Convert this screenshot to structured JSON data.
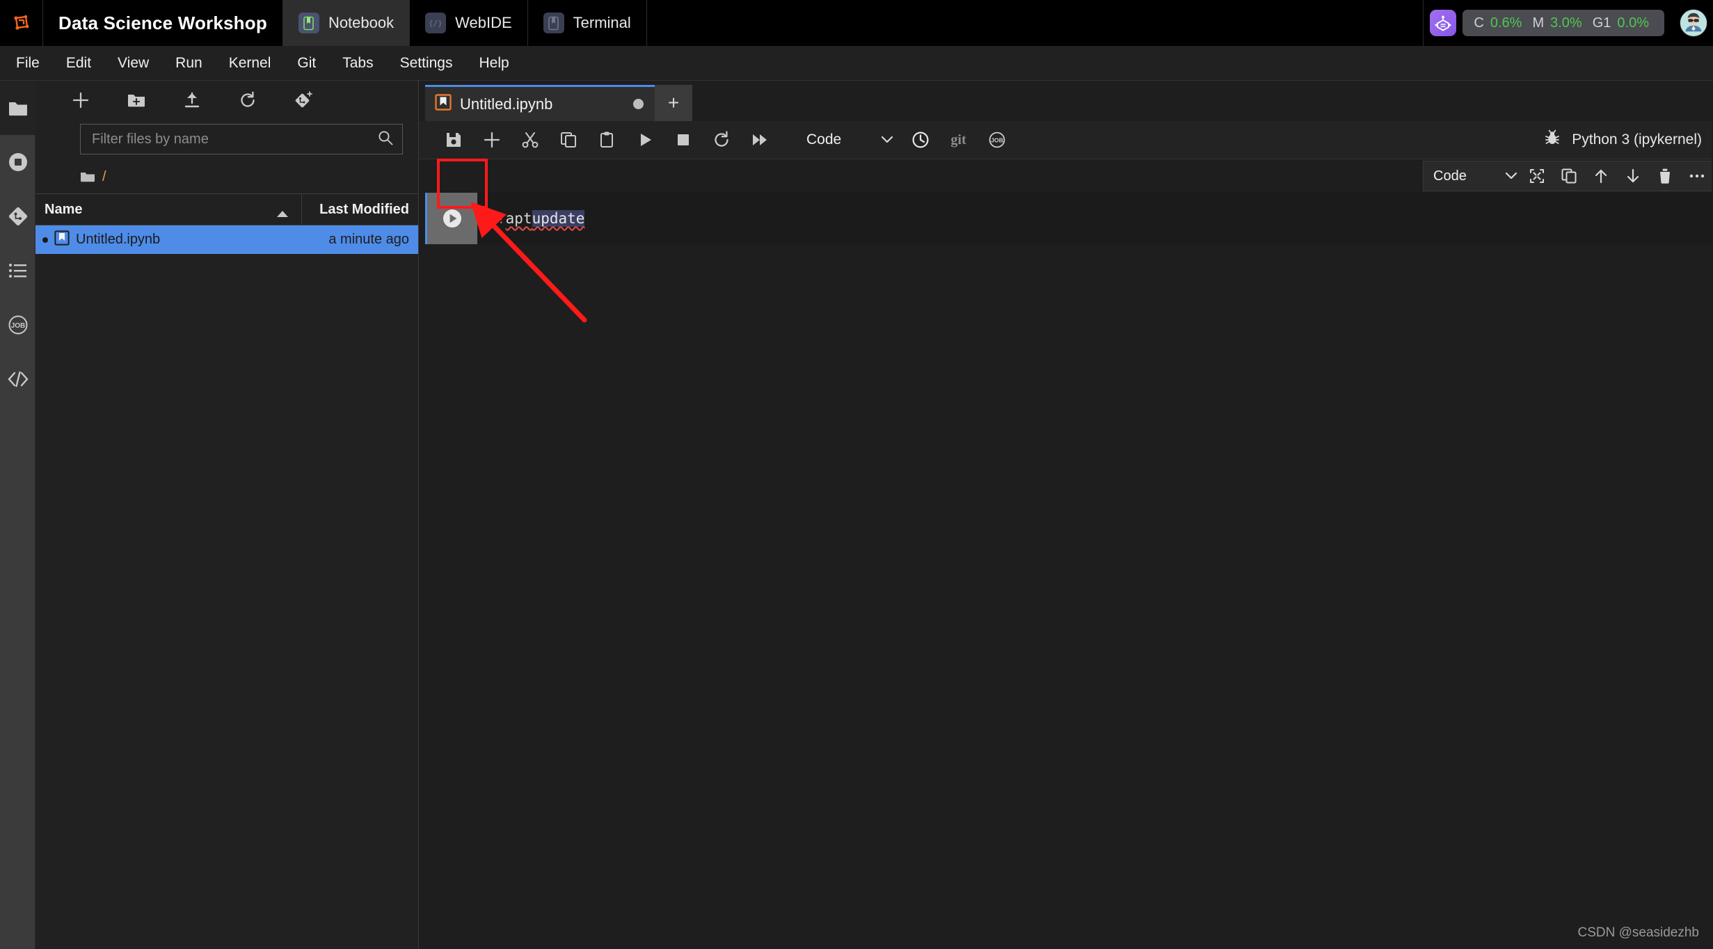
{
  "brand": {
    "logo_icon": "jupyter-like-logo-icon",
    "title": "Data Science Workshop"
  },
  "top_tabs": [
    {
      "label": "Notebook",
      "icon": "notebook-icon",
      "active": true
    },
    {
      "label": "WebIDE",
      "icon": "code-brackets-icon",
      "active": false
    },
    {
      "label": "Terminal",
      "icon": "terminal-icon",
      "active": false
    }
  ],
  "resources": {
    "assistant_icon": "ai-assistant-icon",
    "items": [
      {
        "key": "C",
        "value": "0.6%"
      },
      {
        "key": "M",
        "value": "3.0%"
      },
      {
        "key": "G1",
        "value": "0.0%"
      }
    ],
    "avatar_icon": "user-avatar"
  },
  "menubar": {
    "items": [
      "File",
      "Edit",
      "View",
      "Run",
      "Kernel",
      "Git",
      "Tabs",
      "Settings",
      "Help"
    ]
  },
  "rail": {
    "items": [
      {
        "name": "file-browser",
        "icon": "folder-icon",
        "active": true
      },
      {
        "name": "running-sessions",
        "icon": "stop-circle-icon",
        "active": false
      },
      {
        "name": "git-panel",
        "icon": "git-diamond-icon",
        "active": false
      },
      {
        "name": "table-of-contents",
        "icon": "list-icon",
        "active": false
      },
      {
        "name": "jobs-panel",
        "icon": "job-circle-icon",
        "active": false
      },
      {
        "name": "extensions",
        "icon": "code-slash-icon",
        "active": false
      }
    ]
  },
  "filebrowser": {
    "toolbar": [
      {
        "name": "new-launcher",
        "icon": "plus-icon"
      },
      {
        "name": "new-folder",
        "icon": "new-folder-icon"
      },
      {
        "name": "upload-files",
        "icon": "upload-icon"
      },
      {
        "name": "refresh-listing",
        "icon": "refresh-icon"
      },
      {
        "name": "git-clone",
        "icon": "git-clone-icon"
      }
    ],
    "filter": {
      "placeholder": "Filter files by name",
      "value": "",
      "icon": "search-icon"
    },
    "breadcrumb": {
      "icon": "folder-icon",
      "path": "/"
    },
    "columns": {
      "name": "Name",
      "modified": "Last Modified"
    },
    "sort": "ascending",
    "rows": [
      {
        "name": "Untitled.ipynb",
        "modified": "a minute ago",
        "icon": "notebook-file-icon",
        "selected": true,
        "unsaved": true
      }
    ]
  },
  "notebook": {
    "tab": {
      "title": "Untitled.ipynb",
      "icon": "notebook-file-icon",
      "unsaved_indicator": "●"
    },
    "add_tab_label": "+",
    "toolbar": {
      "buttons": [
        {
          "name": "save-notebook",
          "icon": "save-icon"
        },
        {
          "name": "insert-cell-below",
          "icon": "plus-icon"
        },
        {
          "name": "cut-cells",
          "icon": "scissors-icon"
        },
        {
          "name": "copy-cells",
          "icon": "copy-icon"
        },
        {
          "name": "paste-cells",
          "icon": "paste-icon"
        },
        {
          "name": "run-cell",
          "icon": "play-icon"
        },
        {
          "name": "interrupt-kernel",
          "icon": "stop-square-icon"
        },
        {
          "name": "restart-kernel",
          "icon": "restart-icon"
        },
        {
          "name": "restart-and-run-all",
          "icon": "fast-forward-icon"
        }
      ],
      "cell_type": {
        "value": "Code",
        "caret_icon": "chevron-down-icon"
      },
      "extras": [
        {
          "name": "history",
          "icon": "clock-icon"
        },
        {
          "name": "git-toolbar",
          "icon": "git-text-icon",
          "label": "git"
        },
        {
          "name": "job-toolbar",
          "icon": "job-circle-icon",
          "label": "JOB"
        }
      ],
      "kernel": {
        "debug_icon": "bug-icon",
        "name": "Python 3 (ipykernel)"
      }
    },
    "cell_toolbar": {
      "cell_type": {
        "value": "Code",
        "caret_icon": "chevron-down-icon"
      },
      "buttons": [
        {
          "name": "collapse-cell",
          "icon": "collapse-icon"
        },
        {
          "name": "duplicate-cell",
          "icon": "copy-icon"
        },
        {
          "name": "move-cell-up",
          "icon": "arrow-up-icon"
        },
        {
          "name": "move-cell-down",
          "icon": "arrow-down-icon"
        },
        {
          "name": "delete-cell",
          "icon": "trash-icon"
        },
        {
          "name": "more-options",
          "icon": "ellipsis-icon"
        }
      ]
    },
    "cells": [
      {
        "run_icon": "play-circle-icon",
        "active": true,
        "code_tokens": [
          {
            "text": "!",
            "style": "bang"
          },
          {
            "text": "apt ",
            "style": "cmd"
          },
          {
            "text": "update",
            "style": "selected"
          }
        ]
      }
    ]
  },
  "annotation": {
    "highlight_color": "#ff1a1a",
    "target": "run-cell-gutter-button",
    "arrow": "red-arrow-pointing-to-run-button"
  },
  "watermark": "CSDN @seasidezhb"
}
